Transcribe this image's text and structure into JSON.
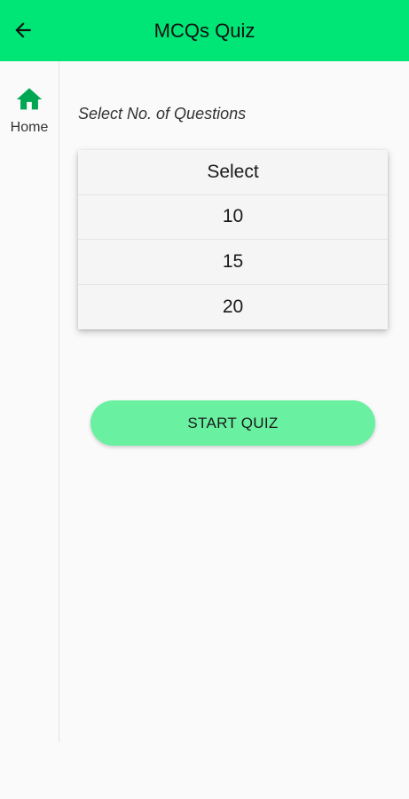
{
  "appbar": {
    "title": "MCQs Quiz",
    "back_icon": "arrow-left-icon",
    "color": "#00e676"
  },
  "rail": {
    "items": [
      {
        "label": "Home",
        "icon": "home-icon",
        "icon_color": "#00a651"
      }
    ]
  },
  "main": {
    "section_label": "Select No. of Questions",
    "dropdown": {
      "options": [
        "Select",
        "10",
        "15",
        "20"
      ]
    },
    "start_button_label": "START QUIZ",
    "start_button_color": "#69f0a0"
  }
}
